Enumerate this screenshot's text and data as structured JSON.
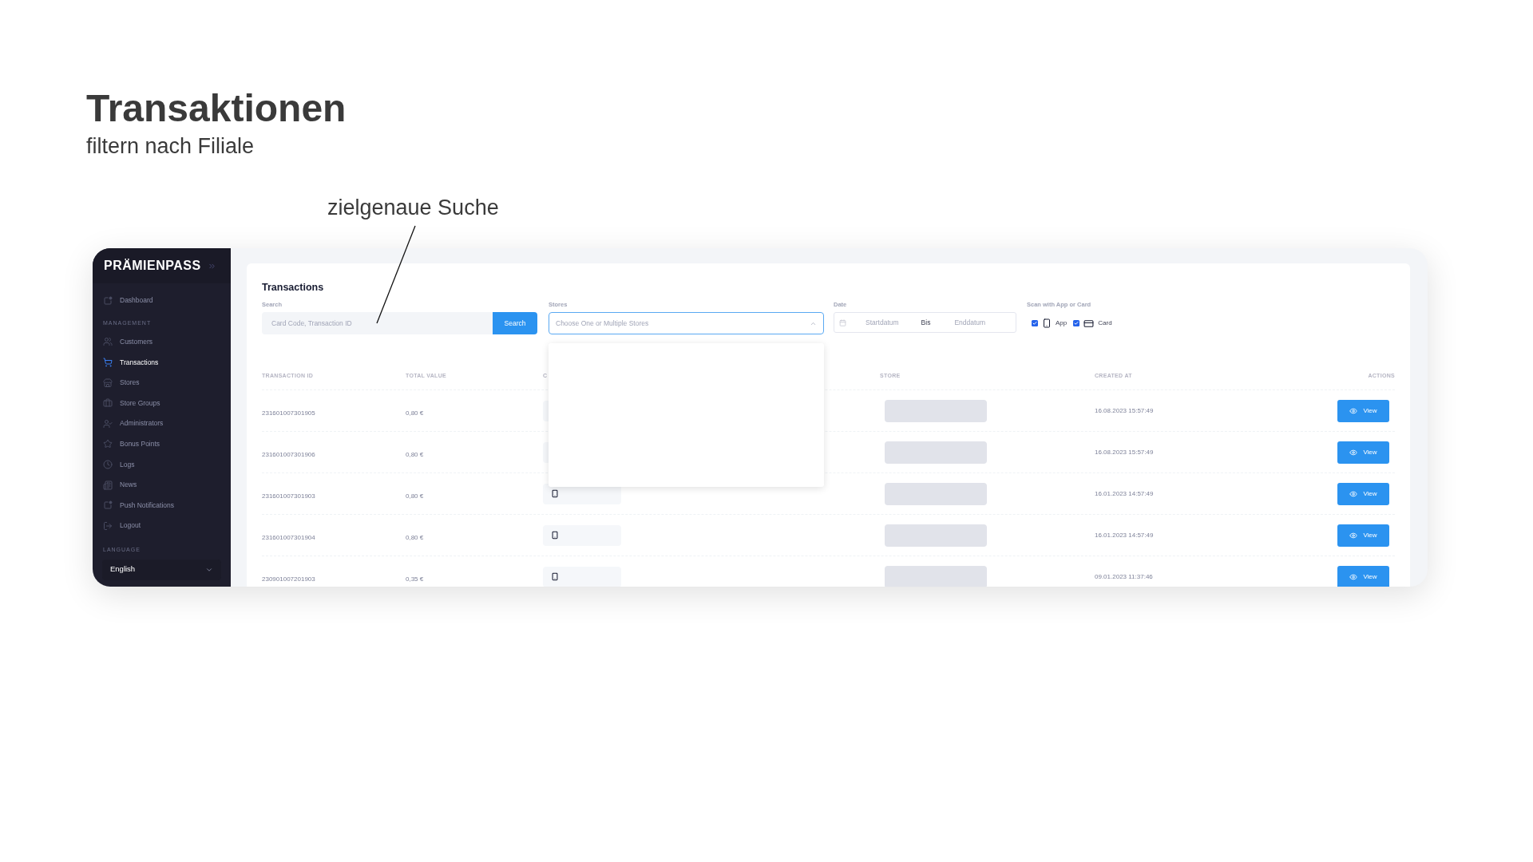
{
  "slide": {
    "title": "Transaktionen",
    "subtitle": "filtern nach Filiale",
    "annotation": "zielgenaue Suche"
  },
  "sidebar": {
    "logo": "PRÄMIENPASS",
    "top_items": [
      {
        "label": "Dashboard",
        "selected": false
      }
    ],
    "section_label": "MANAGEMENT",
    "items": [
      {
        "label": "Customers",
        "selected": false
      },
      {
        "label": "Transactions",
        "selected": true
      },
      {
        "label": "Stores",
        "selected": false
      },
      {
        "label": "Store Groups",
        "selected": false
      },
      {
        "label": "Administrators",
        "selected": false
      },
      {
        "label": "Bonus Points",
        "selected": false
      },
      {
        "label": "Logs",
        "selected": false
      },
      {
        "label": "News",
        "selected": false
      },
      {
        "label": "Push Notifications",
        "selected": false
      },
      {
        "label": "Logout",
        "selected": false
      }
    ],
    "language_label": "LANGUAGE",
    "language_value": "English"
  },
  "main": {
    "title": "Transactions",
    "search": {
      "label": "Search",
      "placeholder": "Card Code, Transaction ID",
      "button": "Search"
    },
    "stores": {
      "label": "Stores",
      "placeholder": "Choose One or Multiple Stores",
      "expanded": true
    },
    "date": {
      "label": "Date",
      "start_placeholder": "Startdatum",
      "separator": "Bis",
      "end_placeholder": "Enddatum"
    },
    "scan": {
      "label": "Scan with App or Card",
      "options": [
        {
          "kind": "app",
          "label": "App",
          "checked": true
        },
        {
          "kind": "card",
          "label": "Card",
          "checked": true
        }
      ]
    },
    "table": {
      "columns": [
        "TRANSACTION ID",
        "TOTAL VALUE",
        "C",
        "STORE",
        "CREATED AT",
        "ACTIONS"
      ],
      "rows": [
        {
          "transaction_id": "231601007301905",
          "total_value": "0,80 €",
          "created_at": "16.08.2023 15:57:49",
          "action": "View"
        },
        {
          "transaction_id": "231601007301906",
          "total_value": "0,80 €",
          "created_at": "16.08.2023 15:57:49",
          "action": "View"
        },
        {
          "transaction_id": "231601007301903",
          "total_value": "0,80 €",
          "created_at": "16.01.2023 14:57:49",
          "action": "View"
        },
        {
          "transaction_id": "231601007301904",
          "total_value": "0,80 €",
          "created_at": "16.01.2023 14:57:49",
          "action": "View"
        },
        {
          "transaction_id": "230901007201903",
          "total_value": "0,35 €",
          "created_at": "09.01.2023 11:37:46",
          "action": "View"
        }
      ]
    }
  }
}
